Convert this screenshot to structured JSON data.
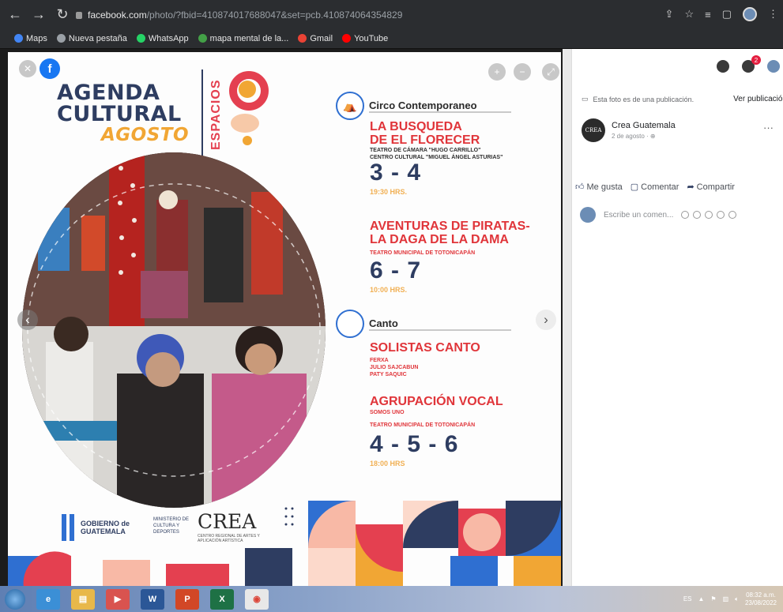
{
  "browser": {
    "url_host": "facebook.com",
    "url_rest": "/photo/?fbid=410874017688047&set=pcb.410874064354829",
    "bookmarks": [
      {
        "label": "Maps",
        "color": "#4285f4"
      },
      {
        "label": "Nueva pestaña",
        "color": "#9aa0a6"
      },
      {
        "label": "WhatsApp",
        "color": "#25d366"
      },
      {
        "label": "mapa mental de la...",
        "color": "#43a047"
      },
      {
        "label": "Gmail",
        "color": "#ea4335"
      },
      {
        "label": "YouTube",
        "color": "#ff0000"
      }
    ]
  },
  "poster": {
    "title_line1": "AGENDA",
    "title_line2": "CULTURAL",
    "title_line3": "AGOSTO",
    "espacios": "ESPACIOS",
    "sections": [
      {
        "label": "Circo Contemporaneo",
        "shows": [
          {
            "title1": "LA BUSQUEDA",
            "title2": "DE EL FLORECER",
            "venue1": "TEATRO DE CÁMARA \"HUGO CARRILLO\"",
            "venue2": "CENTRO CULTURAL \"MIGUEL ÁNGEL ASTURIAS\"",
            "dates": "3 - 4",
            "hours": "19:30 HRS."
          },
          {
            "title1": "AVENTURAS DE PIRATAS-",
            "title2": "LA DAGA DE LA DAMA",
            "venue1": "TEATRO MUNICIPAL DE TOTONICAPÁN",
            "dates": "6 - 7",
            "hours": "10:00 HRS."
          }
        ]
      },
      {
        "label": "Canto",
        "shows": [
          {
            "title1": "SOLISTAS CANTO",
            "performers": [
              "FERXA",
              "JULIO SAJCABUN",
              "PATY SAQUIC"
            ]
          },
          {
            "title1": "AGRUPACIÓN VOCAL",
            "performers": [
              "SOMOS UNO"
            ],
            "venue1": "TEATRO MUNICIPAL DE TOTONICAPÁN",
            "dates": "4 - 5 - 6",
            "hours": "18:00 HRS"
          }
        ]
      }
    ],
    "gov_line1": "GOBIERNO de",
    "gov_line2": "GUATEMALA",
    "ministry": "MINISTERIO DE CULTURA Y DEPORTES",
    "crea": "CREA",
    "crea_sub": "CENTRO REGIONAL DE ARTES Y APLICACIÓN ARTÍSTICA"
  },
  "panel": {
    "post_note": "Esta foto es de una publicación.",
    "see_post": "Ver publicación",
    "page_name": "Crea Guatemala",
    "page_avatar_text": "CREA",
    "post_date": "2 de agosto",
    "like": "Me gusta",
    "comment": "Comentar",
    "share": "Compartir",
    "comment_placeholder": "Escribe un comen...",
    "notifications_badge": "2"
  },
  "taskbar": {
    "time": "08:32 a.m.",
    "date": "23/08/2022",
    "lang": "ES"
  },
  "colors": {
    "navy": "#2e3d61",
    "red": "#e0353a",
    "orange": "#f1a634",
    "blue": "#2f6fd1"
  }
}
